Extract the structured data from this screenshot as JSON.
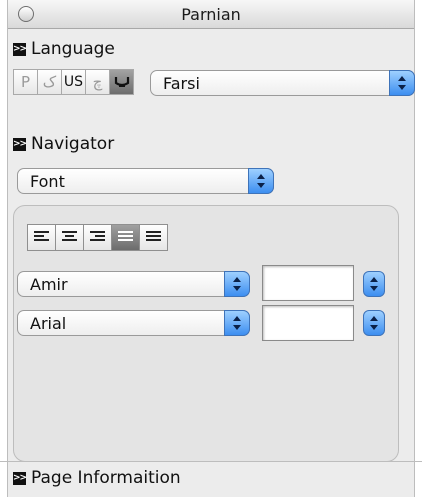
{
  "window": {
    "title": "Parnian"
  },
  "language_section": {
    "heading": "Language",
    "buttons": [
      {
        "label": "P",
        "active": false
      },
      {
        "label": "ک",
        "active": false
      },
      {
        "label": "US",
        "active": false
      },
      {
        "label": "چ",
        "active": false
      },
      {
        "label": "",
        "icon": "keyboard-layout-icon",
        "active": true
      }
    ],
    "language_select": {
      "value": "Farsi"
    }
  },
  "navigator_section": {
    "heading": "Navigator",
    "select": {
      "value": "Font"
    }
  },
  "font_panel": {
    "alignment_buttons": [
      {
        "name": "align-left",
        "active": false
      },
      {
        "name": "align-center",
        "active": false
      },
      {
        "name": "align-right",
        "active": false
      },
      {
        "name": "align-justify-right",
        "active": true
      },
      {
        "name": "align-justify",
        "active": false
      }
    ],
    "font_rows": [
      {
        "font": "Amir",
        "size": ""
      },
      {
        "font": "Arial",
        "size": ""
      }
    ]
  },
  "page_info_section": {
    "heading": "Page Informaition"
  },
  "colors": {
    "accent": "#3d8ef0",
    "active_button": "#7a7a7a"
  }
}
